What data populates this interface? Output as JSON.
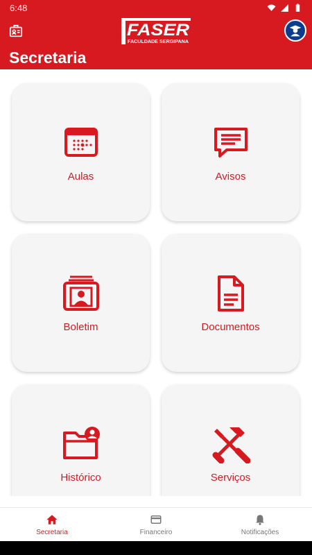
{
  "status_bar": {
    "time": "6:48"
  },
  "header": {
    "logo_main": "FASER",
    "logo_sub": "FACULDADE SERGIPANA",
    "title": "Secretaria"
  },
  "cards": [
    {
      "label": "Aulas",
      "icon": "calendar-icon"
    },
    {
      "label": "Avisos",
      "icon": "chat-icon"
    },
    {
      "label": "Boletim",
      "icon": "profile-card-icon"
    },
    {
      "label": "Documentos",
      "icon": "document-icon"
    },
    {
      "label": "Histórico",
      "icon": "folder-user-icon"
    },
    {
      "label": "Serviços",
      "icon": "tools-icon"
    }
  ],
  "bottom_nav": [
    {
      "label": "Secretaria",
      "icon": "home-icon",
      "active": true
    },
    {
      "label": "Financeiro",
      "icon": "credit-card-icon",
      "active": false
    },
    {
      "label": "Notificações",
      "icon": "bell-icon",
      "active": false
    }
  ],
  "colors": {
    "brand_red": "#d71920",
    "avatar_blue": "#0d3c8f",
    "card_bg": "#f5f5f5"
  }
}
